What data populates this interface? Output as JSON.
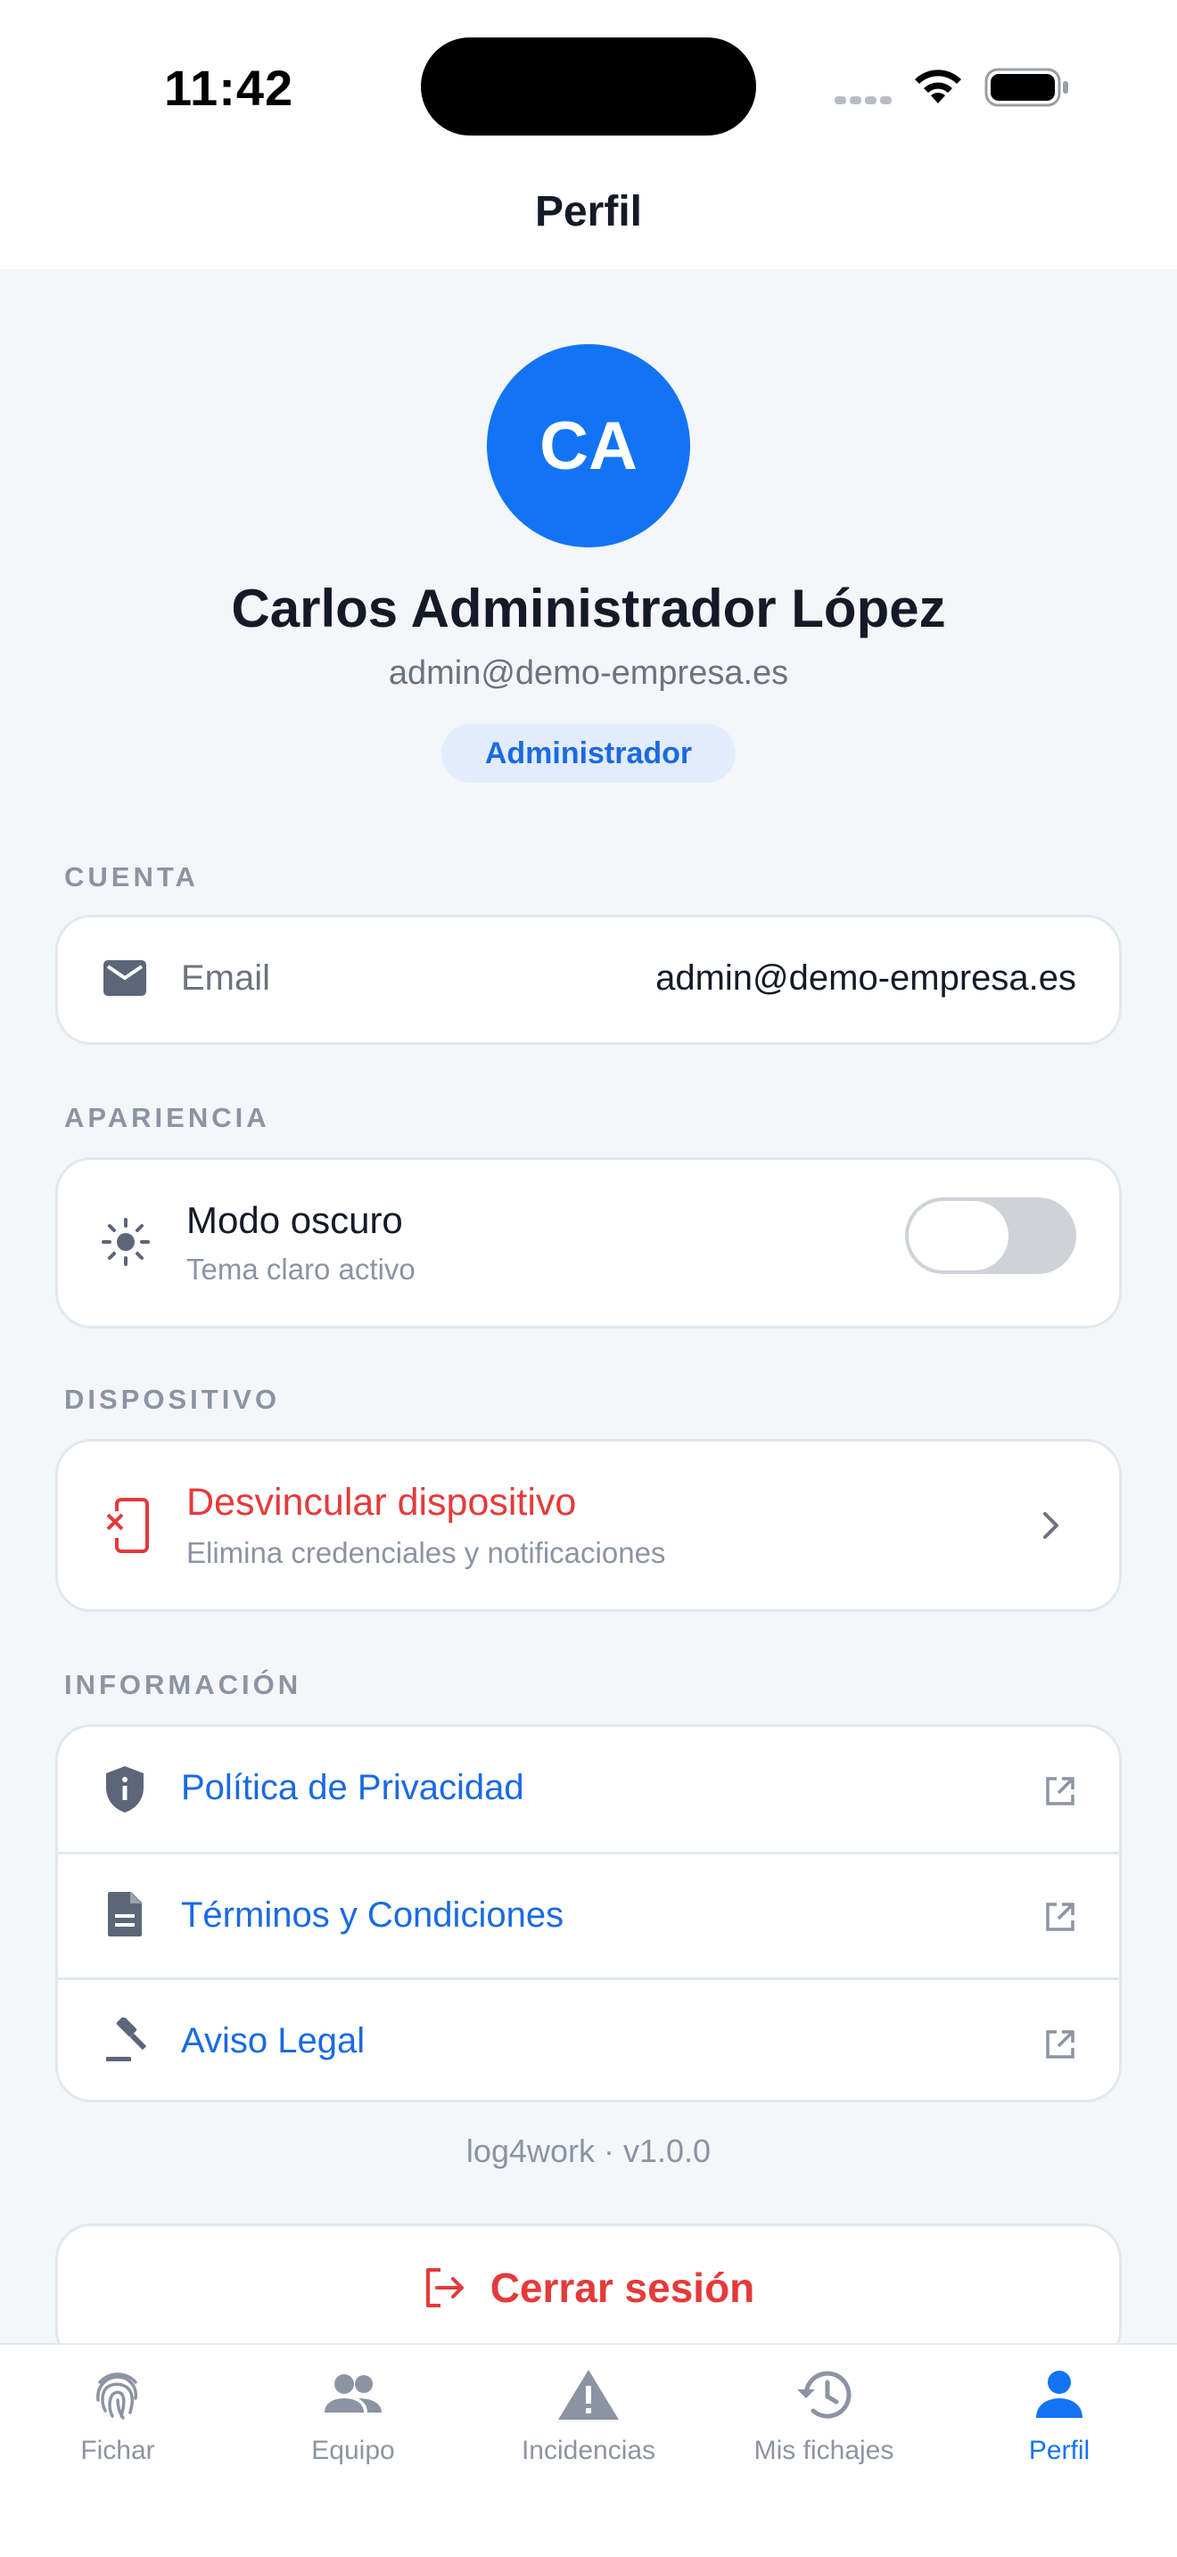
{
  "status_bar": {
    "time": "11:42"
  },
  "header": {
    "title": "Perfil"
  },
  "profile": {
    "initials": "CA",
    "name": "Carlos Administrador López",
    "email": "admin@demo-empresa.es",
    "role": "Administrador"
  },
  "sections": {
    "account": {
      "label": "CUENTA",
      "email_label": "Email",
      "email_value": "admin@demo-empresa.es"
    },
    "appearance": {
      "label": "APARIENCIA",
      "dark_mode_title": "Modo oscuro",
      "dark_mode_subtitle": "Tema claro activo",
      "dark_mode_enabled": false
    },
    "device": {
      "label": "DISPOSITIVO",
      "unlink_title": "Desvincular dispositivo",
      "unlink_subtitle": "Elimina credenciales y notificaciones"
    },
    "info": {
      "label": "INFORMACIÓN",
      "items": [
        {
          "label": "Política de Privacidad",
          "icon": "shield-icon"
        },
        {
          "label": "Términos y Condiciones",
          "icon": "document-icon"
        },
        {
          "label": "Aviso Legal",
          "icon": "gavel-icon"
        }
      ]
    }
  },
  "version": "log4work · v1.0.0",
  "logout_label": "Cerrar sesión",
  "tabs": [
    {
      "label": "Fichar",
      "icon": "fingerprint-icon",
      "active": false
    },
    {
      "label": "Equipo",
      "icon": "team-icon",
      "active": false
    },
    {
      "label": "Incidencias",
      "icon": "warning-icon",
      "active": false
    },
    {
      "label": "Mis fichajes",
      "icon": "history-icon",
      "active": false
    },
    {
      "label": "Perfil",
      "icon": "person-icon",
      "active": true
    }
  ],
  "colors": {
    "primary": "#1274f5",
    "danger": "#e53a3a",
    "muted": "#8c94a3",
    "background": "#f4f6f9"
  }
}
